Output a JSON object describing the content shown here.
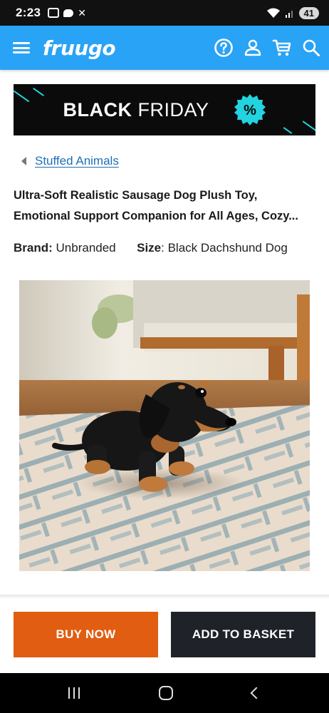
{
  "status_bar": {
    "time": "2:23",
    "battery": "41"
  },
  "header": {
    "logo": "fruugo",
    "icons": [
      "menu-icon",
      "help-icon",
      "account-icon",
      "cart-icon",
      "search-icon"
    ]
  },
  "banner": {
    "text_bold": "BLACK",
    "text_light": "FRIDAY",
    "badge": "%"
  },
  "breadcrumb": {
    "label": "Stuffed Animals"
  },
  "product": {
    "title": "Ultra-Soft Realistic Sausage Dog Plush Toy, Emotional Support Companion for All Ages, Cozy...",
    "brand_label": "Brand:",
    "brand_value": "Unbranded",
    "size_label": "Size",
    "size_value": ": Black Dachshund Dog"
  },
  "actions": {
    "buy_now": "BUY NOW",
    "add_to_basket": "ADD TO BASKET"
  },
  "colors": {
    "header": "#29a3f5",
    "buy_button": "#e05d12",
    "basket_button": "#1f2329",
    "link": "#1f6fb7",
    "banner_accent": "#22d3e0"
  }
}
